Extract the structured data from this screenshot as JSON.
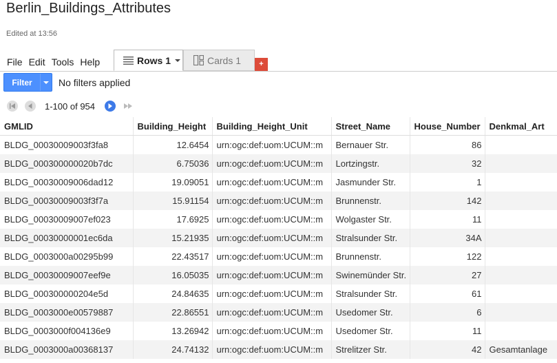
{
  "doc": {
    "title": "Berlin_Buildings_Attributes",
    "edited": "Edited at 13:56"
  },
  "menu": [
    "File",
    "Edit",
    "Tools",
    "Help"
  ],
  "tabs": {
    "rows_label": "Rows 1",
    "cards_label": "Cards 1",
    "add_label": "+"
  },
  "filter": {
    "button_label": "Filter",
    "status": "No filters applied"
  },
  "pager": {
    "range": "1-100 of 954"
  },
  "icons": [
    "first-page-icon",
    "prev-page-icon",
    "next-page-icon",
    "last-page-icon",
    "rows-icon",
    "cards-icon",
    "chevron-down-icon"
  ],
  "colors": {
    "accent": "#4d90fe",
    "add_tab": "#dd4b39",
    "pager_active": "#3d7ae8"
  },
  "table": {
    "columns": [
      "GMLID",
      "Building_Height",
      "Building_Height_Unit",
      "Street_Name",
      "House_Number",
      "Denkmal_Art"
    ],
    "rows": [
      [
        "BLDG_00030009003f3fa8",
        "12.6454",
        "urn:ogc:def:uom:UCUM::m",
        "Bernauer Str.",
        "86",
        ""
      ],
      [
        "BLDG_000300000020b7dc",
        "6.75036",
        "urn:ogc:def:uom:UCUM::m",
        "Lortzingstr.",
        "32",
        ""
      ],
      [
        "BLDG_00030009006dad12",
        "19.09051",
        "urn:ogc:def:uom:UCUM::m",
        "Jasmunder Str.",
        "1",
        ""
      ],
      [
        "BLDG_00030009003f3f7a",
        "15.91154",
        "urn:ogc:def:uom:UCUM::m",
        "Brunnenstr.",
        "142",
        ""
      ],
      [
        "BLDG_00030009007ef023",
        "17.6925",
        "urn:ogc:def:uom:UCUM::m",
        "Wolgaster Str.",
        "11",
        ""
      ],
      [
        "BLDG_00030000001ec6da",
        "15.21935",
        "urn:ogc:def:uom:UCUM::m",
        "Stralsunder Str.",
        "34A",
        ""
      ],
      [
        "BLDG_0003000a00295b99",
        "22.43517",
        "urn:ogc:def:uom:UCUM::m",
        "Brunnenstr.",
        "122",
        ""
      ],
      [
        "BLDG_00030009007eef9e",
        "16.05035",
        "urn:ogc:def:uom:UCUM::m",
        "Swinemünder Str.",
        "27",
        ""
      ],
      [
        "BLDG_000300000204e5d",
        "24.84635",
        "urn:ogc:def:uom:UCUM::m",
        "Stralsunder Str.",
        "61",
        ""
      ],
      [
        "BLDG_0003000e00579887",
        "22.86551",
        "urn:ogc:def:uom:UCUM::m",
        "Usedomer Str.",
        "6",
        ""
      ],
      [
        "BLDG_0003000f004136e9",
        "13.26942",
        "urn:ogc:def:uom:UCUM::m",
        "Usedomer Str.",
        "11",
        ""
      ],
      [
        "BLDG_0003000a00368137",
        "24.74132",
        "urn:ogc:def:uom:UCUM::m",
        "Strelitzer Str.",
        "42",
        "Gesamtanlage"
      ]
    ]
  }
}
